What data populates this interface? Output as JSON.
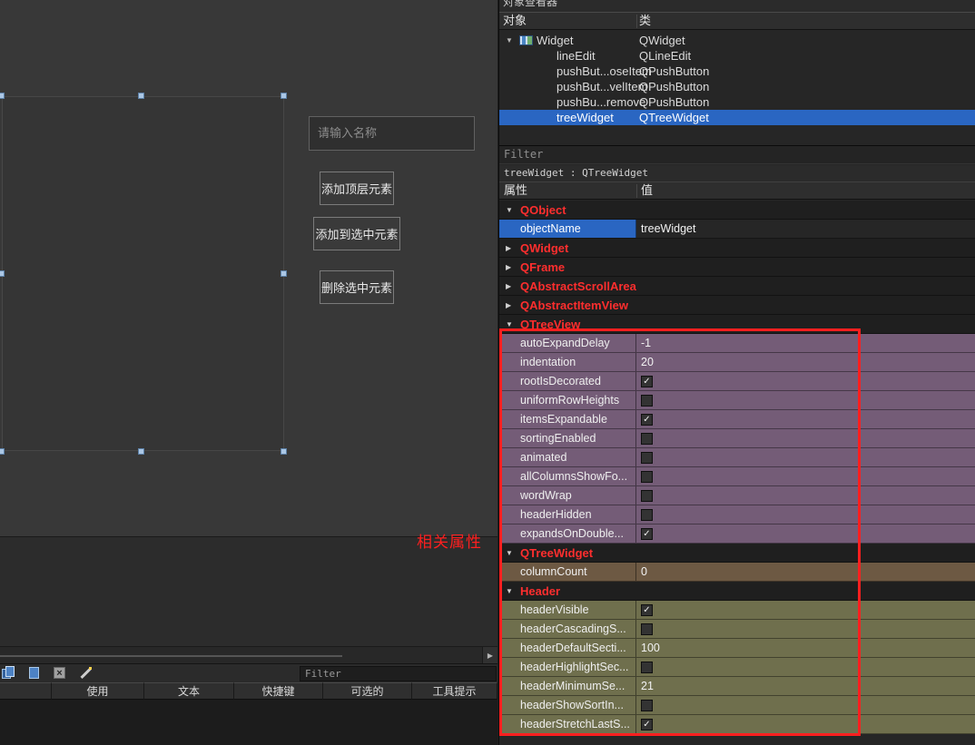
{
  "left": {
    "lineedit_placeholder": "请输入名称",
    "buttons": [
      "添加顶层元素",
      "添加到选中元素",
      "删除选中元素"
    ],
    "annotation": "相关属性",
    "action_filter_placeholder": "Filter",
    "action_table_headers": [
      "使用",
      "文本",
      "快捷键",
      "可选的",
      "工具提示"
    ]
  },
  "object_inspector": {
    "title_partial": "对象查看器",
    "columns": [
      "对象",
      "类"
    ],
    "rows": [
      {
        "name": "Widget",
        "class": "QWidget",
        "level": 0,
        "expanded": true
      },
      {
        "name": "lineEdit",
        "class": "QLineEdit",
        "level": 1
      },
      {
        "name": "pushBut...oseItem",
        "class": "QPushButton",
        "level": 1
      },
      {
        "name": "pushBut...velItem",
        "class": "QPushButton",
        "level": 1
      },
      {
        "name": "pushBu...remove",
        "class": "QPushButton",
        "level": 1
      },
      {
        "name": "treeWidget",
        "class": "QTreeWidget",
        "level": 1,
        "selected": true
      }
    ]
  },
  "property_editor": {
    "filter_placeholder": "Filter",
    "context_label": "treeWidget : QTreeWidget",
    "columns": [
      "属性",
      "值"
    ],
    "rows": [
      {
        "type": "category",
        "label": "QObject",
        "expanded": true
      },
      {
        "type": "prop",
        "name": "objectName",
        "value": "treeWidget",
        "selected": true,
        "bg": "default"
      },
      {
        "type": "category",
        "label": "QWidget",
        "expanded": false
      },
      {
        "type": "category",
        "label": "QFrame",
        "expanded": false
      },
      {
        "type": "category",
        "label": "QAbstractScrollArea",
        "expanded": false
      },
      {
        "type": "category",
        "label": "QAbstractItemView",
        "expanded": false
      },
      {
        "type": "category",
        "label": "QTreeView",
        "expanded": true
      },
      {
        "type": "prop",
        "name": "autoExpandDelay",
        "value": "-1",
        "bg": "purple"
      },
      {
        "type": "prop",
        "name": "indentation",
        "value": "20",
        "bg": "purple"
      },
      {
        "type": "prop",
        "name": "rootIsDecorated",
        "check": true,
        "bg": "purple"
      },
      {
        "type": "prop",
        "name": "uniformRowHeights",
        "check": false,
        "bg": "purple"
      },
      {
        "type": "prop",
        "name": "itemsExpandable",
        "check": true,
        "bg": "purple"
      },
      {
        "type": "prop",
        "name": "sortingEnabled",
        "check": false,
        "bg": "purple"
      },
      {
        "type": "prop",
        "name": "animated",
        "check": false,
        "bg": "purple"
      },
      {
        "type": "prop",
        "name": "allColumnsShowFo...",
        "check": false,
        "bg": "purple"
      },
      {
        "type": "prop",
        "name": "wordWrap",
        "check": false,
        "bg": "purple"
      },
      {
        "type": "prop",
        "name": "headerHidden",
        "check": false,
        "bg": "purple"
      },
      {
        "type": "prop",
        "name": "expandsOnDouble...",
        "check": true,
        "bg": "purple"
      },
      {
        "type": "category",
        "label": "QTreeWidget",
        "expanded": true
      },
      {
        "type": "prop",
        "name": "columnCount",
        "value": "0",
        "bg": "brown"
      },
      {
        "type": "category",
        "label": "Header",
        "expanded": true
      },
      {
        "type": "prop",
        "name": "headerVisible",
        "check": true,
        "bg": "olive"
      },
      {
        "type": "prop",
        "name": "headerCascadingS...",
        "check": false,
        "bg": "olive"
      },
      {
        "type": "prop",
        "name": "headerDefaultSecti...",
        "value": "100",
        "bg": "olive"
      },
      {
        "type": "prop",
        "name": "headerHighlightSec...",
        "check": false,
        "bg": "olive"
      },
      {
        "type": "prop",
        "name": "headerMinimumSe...",
        "value": "21",
        "bg": "olive"
      },
      {
        "type": "prop",
        "name": "headerShowSortIn...",
        "check": false,
        "bg": "olive"
      },
      {
        "type": "prop",
        "name": "headerStretchLastS...",
        "check": true,
        "bg": "olive"
      }
    ]
  },
  "colors": {
    "default": "#262626",
    "purple": "#745c77",
    "brown": "#6d5943",
    "olive": "#6f6f4d",
    "selection_blue": "#2a66c2",
    "category_red": "#ff2e2e",
    "annotation_red": "#ff1f1f"
  }
}
